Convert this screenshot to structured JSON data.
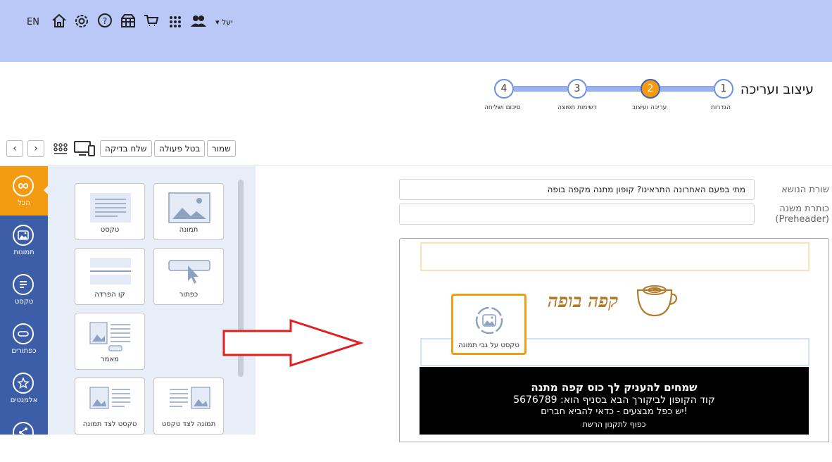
{
  "topbar": {
    "lang": "EN",
    "user": "יעל",
    "icons": [
      "home-icon",
      "gear-icon",
      "help-icon",
      "store-icon",
      "cart-icon",
      "apps-grid-icon",
      "users-icon"
    ]
  },
  "header": {
    "title": "עיצוב ועריכה",
    "steps": [
      {
        "num": "1",
        "label": "הגדרות"
      },
      {
        "num": "2",
        "label": "עריכה ועיצוב"
      },
      {
        "num": "3",
        "label": "רשימות תפוצה"
      },
      {
        "num": "4",
        "label": "סיכום ושליחה"
      }
    ],
    "active_step": 2
  },
  "toolbar": {
    "save": "שמור",
    "undo": "בטל פעולה",
    "send_test": "שלח בדיקה"
  },
  "sidebar": {
    "items": [
      {
        "label": "הכל",
        "icon": "infinity-icon"
      },
      {
        "label": "תמונות",
        "icon": "image-icon"
      },
      {
        "label": "טקסט",
        "icon": "text-icon"
      },
      {
        "label": "כפתורים",
        "icon": "button-icon"
      },
      {
        "label": "אלמנטים",
        "icon": "star-icon"
      },
      {
        "label": "",
        "icon": "share-icon"
      }
    ]
  },
  "palette": {
    "tiles": [
      {
        "label": "תמונה",
        "icon": "image-block-icon"
      },
      {
        "label": "טקסט",
        "icon": "text-block-icon"
      },
      {
        "label": "כפתור",
        "icon": "button-block-icon"
      },
      {
        "label": "קו הפרדה",
        "icon": "divider-block-icon"
      },
      {
        "label": "מאמר",
        "icon": "article-block-icon"
      },
      {
        "label": "תמונה לצד טקסט",
        "icon": "image-text-block-icon"
      },
      {
        "label": "טקסט לצד תמונה",
        "icon": "text-image-block-icon"
      }
    ]
  },
  "editor": {
    "subject_label": "שורת הנושא",
    "subject_value": "מתי בפעם האחרונה התראינו? קופון מתנה מקפה בופה",
    "preheader_label": "כותרת משנה",
    "preheader_label2": "(Preheader)",
    "preheader_value": "",
    "logo_text": "קפה בופה",
    "drag_tile_label": "טקסט על גבי תמונה",
    "block": {
      "line1": "שמחים להעניק לך כוס קפה מתנה",
      "line2": "קוד הקופון לביקורך הבא בסניף הוא: 5676789",
      "line3": "יש כפל מבצעים - כדאי להביא חברים!",
      "line4": "כפוף לתקנון הרשת"
    }
  },
  "colors": {
    "topbar": "#b9c8f7",
    "sidebar": "#3c5da8",
    "accent": "#f39c12",
    "palette_bg": "#e8eef8",
    "logo": "#b37a2a",
    "arrow": "#e02020"
  }
}
